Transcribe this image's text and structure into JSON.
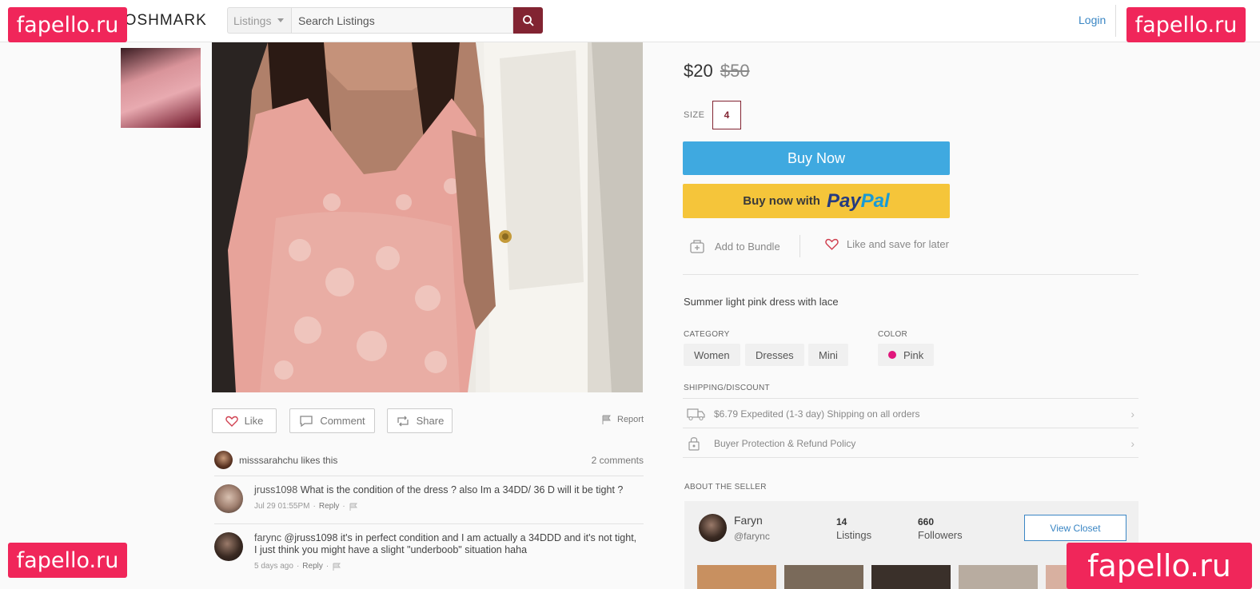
{
  "header": {
    "logo_text": "POSHMARK",
    "search_category": "Listings",
    "search_placeholder": "Search Listings",
    "login_label": "Login"
  },
  "watermark": {
    "text": "fapello.ru",
    "color": "#f0265a"
  },
  "listing": {
    "price": "$20",
    "original_price": "$50",
    "size_label": "SIZE",
    "size_value": "4",
    "buy_now_label": "Buy Now",
    "paypal_prefix": "Buy now with",
    "paypal_word_1": "Pay",
    "paypal_word_2": "Pal",
    "add_to_bundle_label": "Add to Bundle",
    "like_save_label": "Like and save for later",
    "description": "Summer light pink dress with lace",
    "category_label": "CATEGORY",
    "categories": [
      "Women",
      "Dresses",
      "Mini"
    ],
    "color_label": "COLOR",
    "color_value": "Pink",
    "color_hex": "#e0167b",
    "shipping_label": "SHIPPING/DISCOUNT",
    "shipping_rows": [
      "$6.79 Expedited (1-3 day) Shipping on all orders",
      "Buyer Protection & Refund Policy"
    ]
  },
  "actions": {
    "like_label": "Like",
    "comment_label": "Comment",
    "share_label": "Share",
    "report_label": "Report"
  },
  "social": {
    "likes_text": "misssarahchu likes this",
    "comments_count": "2 comments",
    "comments": [
      {
        "user": "jruss1098",
        "text": "What is the condition of the dress ? also Im a 34DD/ 36 D will it be tight ?",
        "time": "Jul 29 01:55PM",
        "reply": "Reply"
      },
      {
        "user": "farync",
        "text": "@jruss1098 it's in perfect condition and I am actually a 34DDD and it's not tight, I just think you might have a slight \"underboob\" situation haha",
        "time": "5 days ago",
        "reply": "Reply"
      }
    ]
  },
  "seller": {
    "section_label": "ABOUT THE SELLER",
    "name": "Faryn",
    "handle": "@farync",
    "listings_count": "14",
    "listings_label": "Listings",
    "followers_count": "660",
    "followers_label": "Followers",
    "view_closet_label": "View Closet"
  },
  "colors": {
    "brand": "#822432",
    "buy_now": "#3fa9e0",
    "paypal": "#f5c53a",
    "link": "#3a86c4"
  }
}
